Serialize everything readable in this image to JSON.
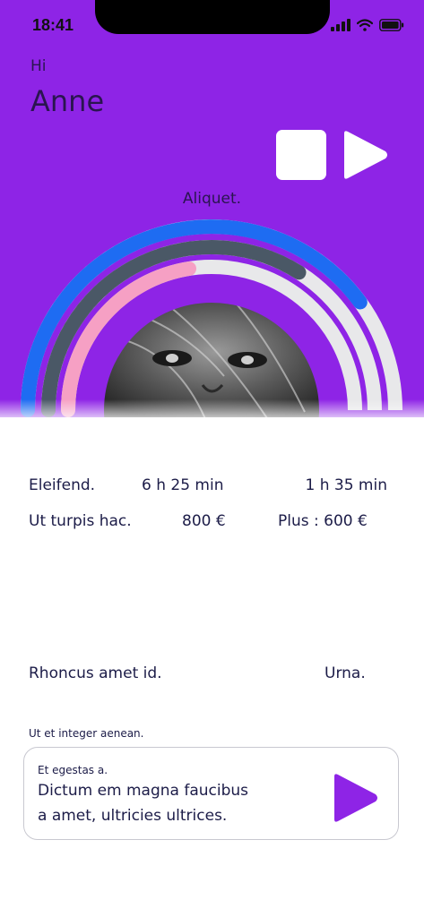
{
  "status_bar": {
    "time": "18:41"
  },
  "header": {
    "greeting": "Hi",
    "name": "Anne"
  },
  "controls": {
    "stop_icon": "stop-icon",
    "play_icon": "play-icon"
  },
  "hero": {
    "label": "Aliquet."
  },
  "progress": {
    "outer_ring_fraction": 0.8,
    "middle_ring_fraction": 0.68,
    "inner_ring_fraction": 0.45,
    "colors": {
      "outer": "#1e6cf2",
      "middle": "#4a5866",
      "inner": "#f6a0c4",
      "track": "#e8e8ea",
      "background": "#8e24e6"
    }
  },
  "stats": [
    {
      "label": "Eleifend.",
      "value": "6 h 25 min",
      "extra": "1 h 35 min"
    },
    {
      "label": "Ut turpis hac.",
      "value": "800 €",
      "extra": "Plus : 600 €"
    }
  ],
  "section": {
    "left": "Rhoncus amet id.",
    "right": "Urna."
  },
  "card": {
    "label": "Ut et integer aenean.",
    "kicker": "Et egestas a.",
    "line1": "Dictum em magna faucibus",
    "line2": "a amet, ultricies ultrices."
  }
}
